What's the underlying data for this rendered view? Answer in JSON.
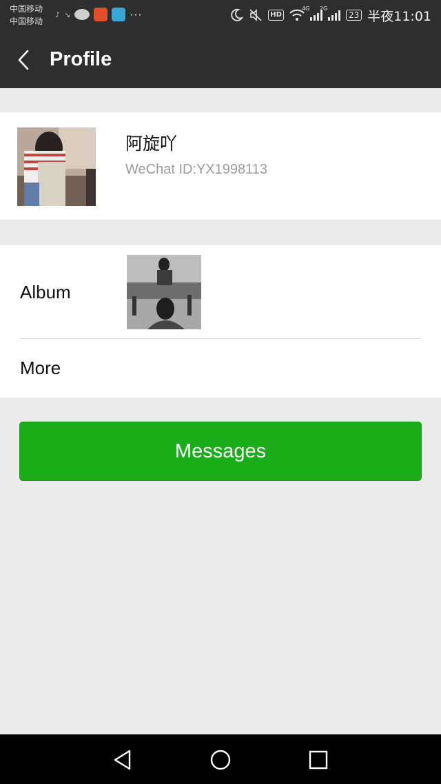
{
  "status_bar": {
    "carrier_1": "中国移动",
    "carrier_2": "中国移动",
    "network_1": "4G",
    "network_2": "2G",
    "hd": "HD",
    "battery": "23",
    "time": "半夜11:01",
    "more": "···"
  },
  "header": {
    "title": "Profile",
    "back_icon": "chevron-left-icon"
  },
  "profile": {
    "name": "阿旋吖",
    "wechat_id": "WeChat ID:YX1998113"
  },
  "rows": {
    "album_label": "Album",
    "more_label": "More"
  },
  "actions": {
    "messages_label": "Messages"
  },
  "colors": {
    "header_bg": "#2e2e2e",
    "page_bg": "#ebebeb",
    "button_green": "#1aad19",
    "secondary_text": "#9a9a9a"
  }
}
